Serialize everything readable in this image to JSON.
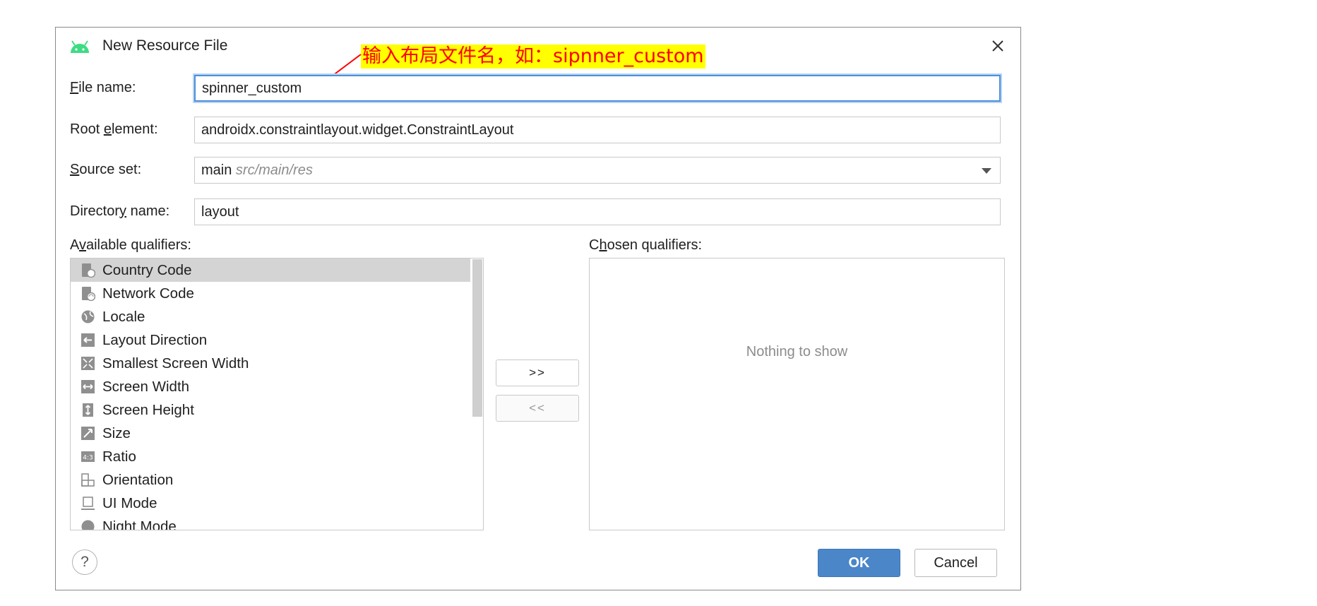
{
  "dialog": {
    "title": "New Resource File",
    "icons": {
      "app": "android-icon",
      "close": "close-icon",
      "help": "help-icon"
    }
  },
  "annotation": {
    "text": "输入布局文件名，如：sipnner_custom",
    "text_color": "#ff0000",
    "highlight_color": "#ffff00"
  },
  "form": {
    "file_name": {
      "label_mnemonic": "F",
      "label_rest": "ile name:",
      "value": "spinner_custom"
    },
    "root_element": {
      "label_before": "Root ",
      "label_mnemonic": "e",
      "label_after": "lement:",
      "value": "androidx.constraintlayout.widget.ConstraintLayout"
    },
    "source_set": {
      "label_mnemonic": "S",
      "label_rest": "ource set:",
      "value": "main",
      "hint": "src/main/res"
    },
    "directory_name": {
      "label_before": "Director",
      "label_mnemonic": "y",
      "label_after": " name:",
      "value": "layout"
    }
  },
  "available": {
    "label_before": "A",
    "label_mnemonic": "v",
    "label_after": "ailable qualifiers:",
    "items": [
      {
        "label": "Country Code",
        "icon": "country-code-icon",
        "selected": true
      },
      {
        "label": "Network Code",
        "icon": "network-code-icon"
      },
      {
        "label": "Locale",
        "icon": "globe-icon"
      },
      {
        "label": "Layout Direction",
        "icon": "layout-direction-icon"
      },
      {
        "label": "Smallest Screen Width",
        "icon": "smallest-screen-width-icon"
      },
      {
        "label": "Screen Width",
        "icon": "screen-width-icon"
      },
      {
        "label": "Screen Height",
        "icon": "screen-height-icon"
      },
      {
        "label": "Size",
        "icon": "size-icon"
      },
      {
        "label": "Ratio",
        "icon": "ratio-icon"
      },
      {
        "label": "Orientation",
        "icon": "orientation-icon"
      },
      {
        "label": "UI Mode",
        "icon": "ui-mode-icon"
      },
      {
        "label": "Night Mode",
        "icon": "night-mode-icon"
      }
    ]
  },
  "buttons": {
    "add": ">>",
    "remove": "<<",
    "ok": "OK",
    "cancel": "Cancel",
    "help": "?"
  },
  "chosen": {
    "label_before": "C",
    "label_mnemonic": "h",
    "label_after": "osen qualifiers:",
    "empty": "Nothing to show"
  },
  "colors": {
    "accent": "#4a86c8",
    "focus": "#4a90d9",
    "selection": "#d4d4d4",
    "android": "#3ddc84"
  }
}
